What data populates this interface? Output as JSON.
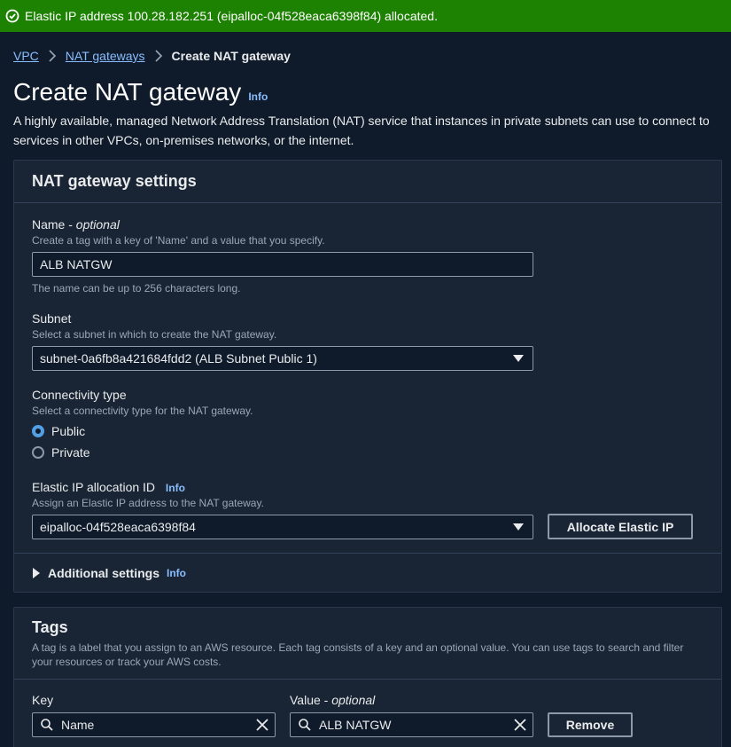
{
  "banner": {
    "message": "Elastic IP address 100.28.182.251 (eipalloc-04f528eaca6398f84) allocated.",
    "icon": "check-circle-icon",
    "color": "#1d8102"
  },
  "breadcrumb": {
    "items": [
      "VPC",
      "NAT gateways"
    ],
    "current": "Create NAT gateway"
  },
  "page": {
    "title": "Create NAT gateway",
    "info": "Info",
    "description": "A highly available, managed Network Address Translation (NAT) service that instances in private subnets can use to connect to services in other VPCs, on-premises networks, or the internet."
  },
  "settings": {
    "header": "NAT gateway settings",
    "name": {
      "label": "Name - ",
      "optional": "optional",
      "description": "Create a tag with a key of 'Name' and a value that you specify.",
      "value": "ALB NATGW",
      "constraint": "The name can be up to 256 characters long."
    },
    "subnet": {
      "label": "Subnet",
      "description": "Select a subnet in which to create the NAT gateway.",
      "value": "subnet-0a6fb8a421684fdd2 (ALB Subnet Public 1)"
    },
    "connectivity": {
      "label": "Connectivity type",
      "description": "Select a connectivity type for the NAT gateway.",
      "options": [
        "Public",
        "Private"
      ],
      "selected": "Public"
    },
    "eip": {
      "label": "Elastic IP allocation ID",
      "info": "Info",
      "description": "Assign an Elastic IP address to the NAT gateway.",
      "value": "eipalloc-04f528eaca6398f84",
      "allocate_button": "Allocate Elastic IP"
    },
    "additional": {
      "label": "Additional settings",
      "info": "Info"
    }
  },
  "tags": {
    "header": "Tags",
    "description": "A tag is a label that you assign to an AWS resource. Each tag consists of a key and an optional value. You can use tags to search and filter your resources or track your AWS costs.",
    "key_label": "Key",
    "value_label": "Value - ",
    "value_optional": "optional",
    "rows": [
      {
        "key": "Name",
        "value": "ALB NATGW",
        "remove": "Remove"
      }
    ]
  },
  "colors": {
    "background": "#0f1b2a",
    "panel": "#192534",
    "link": "#89bdff",
    "accent": "#539fe5"
  }
}
